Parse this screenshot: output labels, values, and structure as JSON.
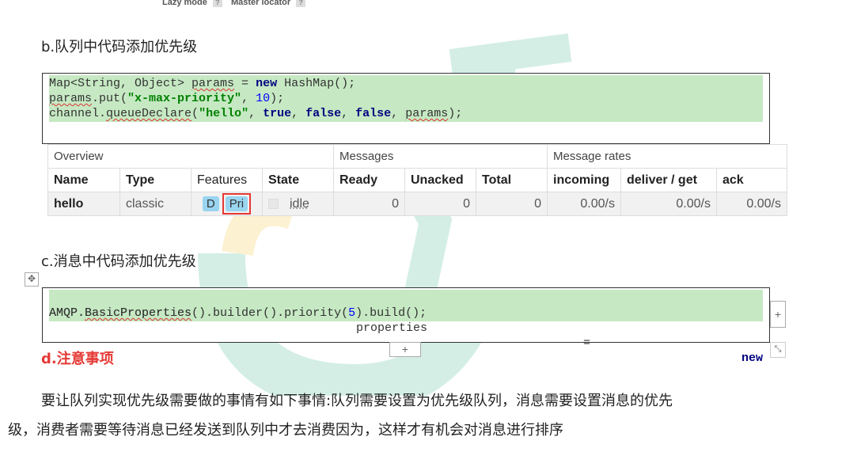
{
  "top_strip": {
    "lazy_mode": "Lazy mode",
    "master_locator": "Master locator",
    "help_mark": "?"
  },
  "section_b": {
    "heading": "b.队列中代码添加优先级",
    "code": {
      "l1_a": "Map<String, Object> ",
      "l1_b": "params",
      "l1_c": " = ",
      "l1_kw": "new",
      "l1_d": " HashMap();",
      "l2_a": "params",
      "l2_b": ".put(",
      "l2_str": "\"x-max-priority\"",
      "l2_c": ", ",
      "l2_num": "10",
      "l2_d": ");",
      "l3_a": "channel.",
      "l3_b": "queueDeclare",
      "l3_c": "(",
      "l3_str": "\"hello\"",
      "l3_d": ", ",
      "l3_kw1": "true",
      "l3_e": ", ",
      "l3_kw2": "false",
      "l3_f": ", ",
      "l3_kw3": "false",
      "l3_g": ", ",
      "l3_h": "params",
      "l3_i": ");"
    }
  },
  "queue_table": {
    "groups": [
      "Overview",
      "Messages",
      "Message rates"
    ],
    "columns": [
      "Name",
      "Type",
      "Features",
      "State",
      "Ready",
      "Unacked",
      "Total",
      "incoming",
      "deliver / get",
      "ack"
    ],
    "row": {
      "name": "hello",
      "type": "classic",
      "feature_d": "D",
      "feature_pri": "Pri",
      "state": "idle",
      "ready": "0",
      "unacked": "0",
      "total": "0",
      "incoming": "0.00/s",
      "deliver_get": "0.00/s",
      "ack": "0.00/s"
    }
  },
  "section_c": {
    "heading": "c.消息中代码添加优先级",
    "code": {
      "l1_a": "AMQP.BasicProperties",
      "l1_b": "properties",
      "l1_c": "=",
      "l1_kw": "new",
      "l2_a": "AMQP.",
      "l2_b": "BasicProperties",
      "l2_c": "().builder().priority(",
      "l2_num": "5",
      "l2_d": ").build();"
    }
  },
  "section_d": {
    "heading": "d.注意事项",
    "para_line1": "要让队列实现优先级需要做的事情有如下事情:队列需要设置为优先级队列，消息需要设置消息的优先",
    "para_line2": "级，消费者需要等待消息已经发送到队列中才去消费因为，这样才有机会对消息进行排序"
  },
  "controls": {
    "plus": "+"
  },
  "colors": {
    "code_highlight": "#c6e9c3",
    "accent_red": "#e53935",
    "feature_tag": "#99d5f0"
  }
}
